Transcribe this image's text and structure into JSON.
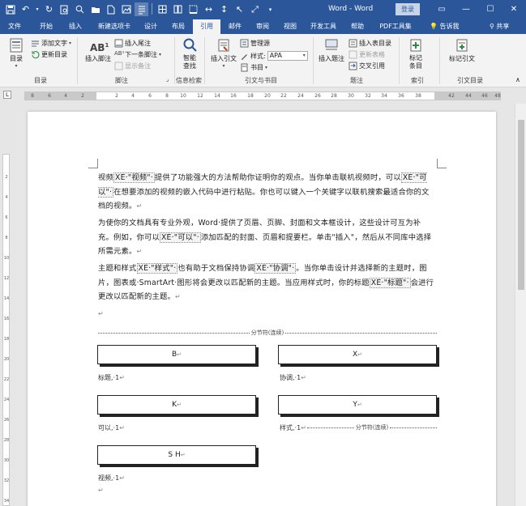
{
  "titlebar": {
    "doc_title": "Word - Word",
    "login": "登录",
    "qat_icons": [
      "save-icon",
      "undo-icon",
      "undo-dropdown-icon",
      "redo-icon",
      "print-preview-icon",
      "find-icon",
      "open-icon",
      "new-doc-icon",
      "gallery-icon",
      "format-icon",
      "more-icon"
    ]
  },
  "tabs": [
    "文件",
    "开始",
    "插入",
    "新建选项卡",
    "设计",
    "布局",
    "引用",
    "邮件",
    "审阅",
    "视图",
    "开发工具",
    "帮助",
    "PDF工具集"
  ],
  "active_tab": "引用",
  "tell_me": "告诉我",
  "share": "共享",
  "ribbon": {
    "toc": {
      "button": "目录",
      "add_text": "添加文字",
      "update_toc": "更新目录",
      "group": "目录"
    },
    "footnotes": {
      "insert_footnote": "插入脚注",
      "insert_endnote": "插入尾注",
      "next_footnote": "下一条脚注",
      "show_notes": "显示备注",
      "group": "脚注"
    },
    "research": {
      "smart_lookup": "智能查找",
      "group": "信息检索"
    },
    "citations": {
      "insert_citation": "插入引文",
      "manage_sources": "管理源",
      "style_label": "样式:",
      "style_value": "APA",
      "bibliography": "书目",
      "group": "引文与书目"
    },
    "captions": {
      "insert_caption": "插入题注",
      "insert_table_of_figures": "插入表目录",
      "update_table": "更新表格",
      "cross_reference": "交叉引用",
      "group": "题注"
    },
    "index": {
      "mark_entry": "标记条目",
      "group": "索引"
    },
    "toa": {
      "mark_citation": "标记引文",
      "group": "引文目录"
    }
  },
  "ruler": {
    "numbers": [
      "8",
      "6",
      "4",
      "2",
      "",
      "2",
      "4",
      "6",
      "8",
      "10",
      "12",
      "14",
      "16",
      "18",
      "20",
      "22",
      "24",
      "26",
      "28",
      "30",
      "32",
      "34",
      "36",
      "38",
      "",
      "42",
      "44",
      "46",
      "48"
    ],
    "vnumbers": [
      "2",
      "4",
      "6",
      "8",
      "10",
      "12",
      "14",
      "16",
      "18",
      "20",
      "22",
      "24",
      "26",
      "28",
      "30",
      "32",
      "34"
    ]
  },
  "document": {
    "para1": {
      "t1": "视频",
      "f1": "XE·\"视频\"·",
      "t2": "提供了功能强大的方法帮助你证明你的观点。当你单击联机视频时，可以",
      "f2": "XE·\"可以\"·",
      "t3": "在想要添加的视频的嵌入代码中进行粘贴。你也可以键入一个关键字以联机搜索最适合你的文档的视频。"
    },
    "para2": {
      "t1": "为使你的文档具有专业外观，Word·提供了页眉、页脚、封面和文本框设计，这些设计可互为补充。例如，你可以",
      "f1": "XE·\"可以\"·",
      "t2": "添加匹配的封面、页眉和提要栏。单击\"插入\"，然后从不同库中选择所需元素。"
    },
    "para3": {
      "t1": "主题和样式",
      "f1": "XE·\"样式\"·",
      "t2": "也有助于文档保持协调",
      "f2": "XE·\"协调\"·",
      "t3": "。当你单击设计并选择新的主题时，图片，图表或·SmartArt·图形将会更改以匹配新的主题。当应用样式时，你的标题",
      "f3": "XE·\"标题\"·",
      "t4": "会进行更改以匹配新的主题。"
    },
    "pilcrow": "↵",
    "section_break": "分节符(连续)",
    "index_headings": [
      "B",
      "X",
      "K",
      "Y",
      "S H"
    ],
    "index_entries": [
      "标题,·1",
      "协调,·1",
      "可以,·1",
      "样式,·1",
      "视频,·1"
    ]
  },
  "colors": {
    "word_blue": "#2b579a",
    "ribbon_bg": "#f3f3f3",
    "canvas": "#e6e6e6"
  }
}
